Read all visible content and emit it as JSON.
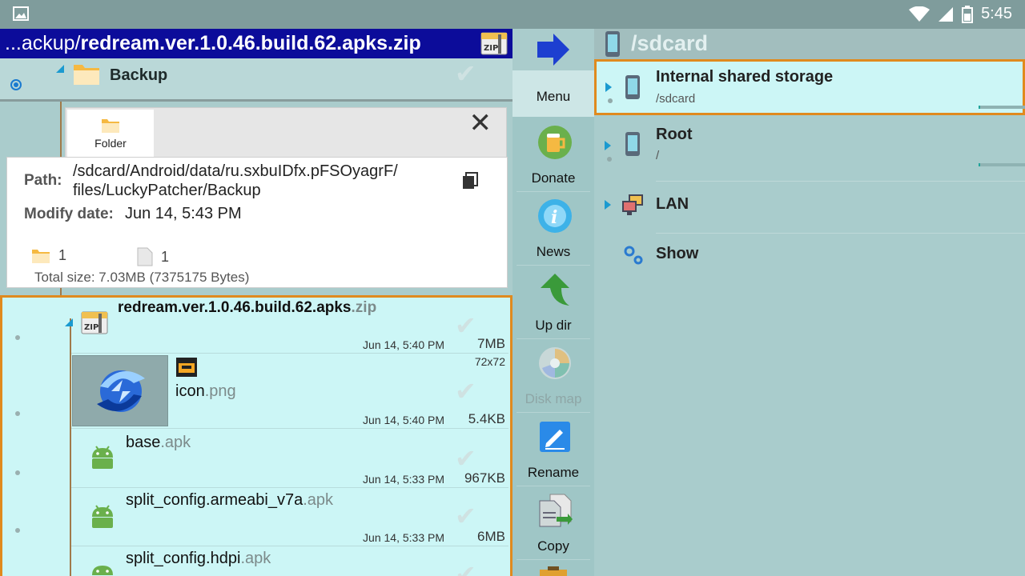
{
  "status": {
    "time": "5:45"
  },
  "path_bar": {
    "prefix": "...ackup/",
    "name": "redream.ver.1.0.46.build.62.apks.zip"
  },
  "backup_folder": {
    "name": "Backup"
  },
  "info_popup": {
    "tab_label": "Folder",
    "path_label": "Path:",
    "path_line1": "/sdcard/Android/data/ru.sxbuIDfx.pFSOyagrF/",
    "path_line2": "files/LuckyPatcher/Backup",
    "modify_label": "Modify date:",
    "modify_value": "Jun 14, 5:43 PM",
    "folder_count": "1",
    "file_count": "1",
    "total_size": "Total size:  7.03MB (7375175 Bytes)"
  },
  "files": [
    {
      "base": "redream.ver.1.0.46.build.62.apks",
      "ext": ".zip",
      "date": "Jun 14, 5:40 PM",
      "size": "7MB"
    },
    {
      "base": "icon",
      "ext": ".png",
      "date": "Jun 14, 5:40 PM",
      "size": "5.4KB",
      "dims": "72x72"
    },
    {
      "base": "base",
      "ext": ".apk",
      "date": "Jun 14, 5:33 PM",
      "size": "967KB"
    },
    {
      "base": "split_config.armeabi_v7a",
      "ext": ".apk",
      "date": "Jun 14, 5:33 PM",
      "size": "6MB"
    },
    {
      "base": "split_config.hdpi",
      "ext": ".apk"
    }
  ],
  "toolbar": {
    "menu": "Menu",
    "donate": "Donate",
    "news": "News",
    "updir": "Up dir",
    "diskmap": "Disk map",
    "rename": "Rename",
    "copy": "Copy"
  },
  "right_pane": {
    "title": "/sdcard",
    "items": [
      {
        "name": "Internal shared storage",
        "sub": "/sdcard"
      },
      {
        "name": "Root",
        "sub": "/"
      },
      {
        "name": "LAN"
      },
      {
        "name": "Show"
      }
    ]
  },
  "colors": {
    "path_bar": "#0c0c9a",
    "selection_border": "#e08a1e",
    "selected_bg": "#ccf6f6",
    "accent": "#1a9ad0"
  }
}
